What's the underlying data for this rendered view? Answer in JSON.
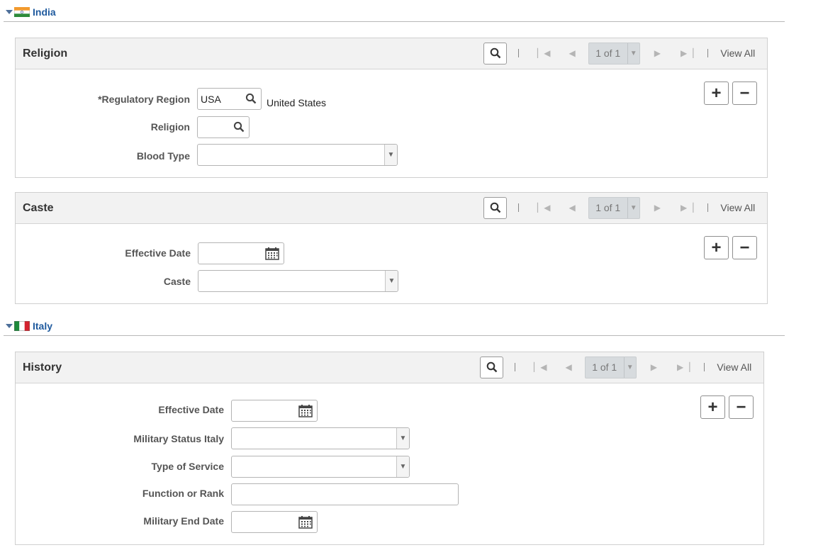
{
  "india": {
    "name": "India",
    "religion_panel": {
      "title": "Religion",
      "pager": "1 of 1",
      "view_all": "View All",
      "fields": {
        "regulatory_region_label": "*Regulatory Region",
        "regulatory_region_value": "USA",
        "regulatory_region_desc": "United States",
        "religion_label": "Religion",
        "religion_value": "",
        "blood_type_label": "Blood Type",
        "blood_type_value": ""
      }
    },
    "caste_panel": {
      "title": "Caste",
      "pager": "1 of 1",
      "view_all": "View All",
      "fields": {
        "effective_date_label": "Effective Date",
        "effective_date_value": "",
        "caste_label": "Caste",
        "caste_value": ""
      }
    }
  },
  "italy": {
    "name": "Italy",
    "history_panel": {
      "title": "History",
      "pager": "1 of 1",
      "view_all": "View All",
      "fields": {
        "effective_date_label": "Effective Date",
        "effective_date_value": "",
        "military_status_label": "Military Status Italy",
        "military_status_value": "",
        "type_of_service_label": "Type of Service",
        "type_of_service_value": "",
        "function_rank_label": "Function or Rank",
        "function_rank_value": "",
        "military_end_date_label": "Military End Date",
        "military_end_date_value": ""
      }
    }
  },
  "icons": {
    "collapse": "collapse-triangle-icon",
    "search": "magnifier-icon",
    "first": "first-page-icon",
    "prev": "previous-page-icon",
    "next": "next-page-icon",
    "last": "last-page-icon",
    "add": "plus-icon",
    "delete": "minus-icon",
    "calendar": "calendar-icon",
    "dropdown": "chevron-down-icon"
  },
  "colors": {
    "link": "#1f5a9e",
    "panel_header": "#f2f2f2",
    "pager": "#d7dbde"
  }
}
